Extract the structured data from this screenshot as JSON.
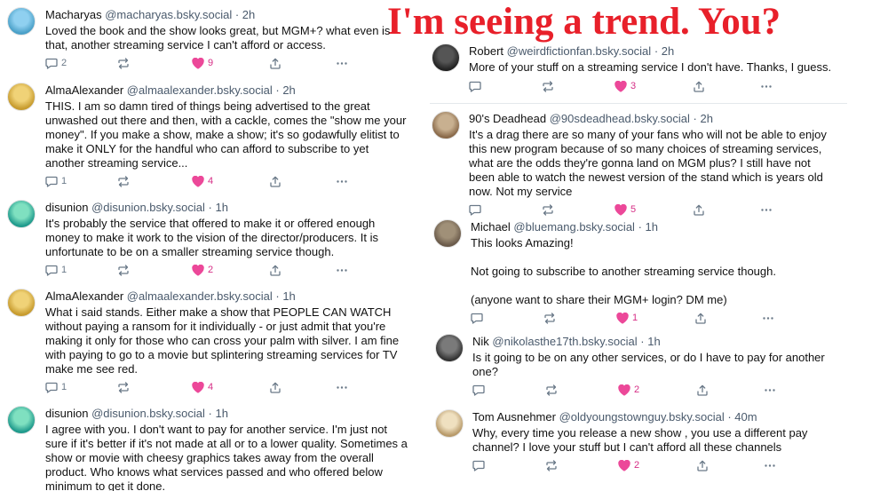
{
  "overlay": {
    "title": "I'm seeing a trend. You?"
  },
  "colors": {
    "heart": "#ec4899",
    "handle": "#4a5a6c",
    "overlay": "#e8202a"
  },
  "posts": [
    {
      "name": "Macharyas",
      "handle": "@macharyas.bsky.social",
      "time": "· 2h",
      "text": "Loved the book and the show looks great, but MGM+? what even is\nthat, another streaming service I can't afford or access.",
      "replies": "2",
      "reposts": "",
      "likes": "9",
      "liked": true
    },
    {
      "name": "AlmaAlexander",
      "handle": "@almaalexander.bsky.social",
      "time": "· 2h",
      "text": "THIS. I am so damn tired of things being advertised to the great\nunwashed out there and then, with a cackle, comes the \"show me your\nmoney\". If you make a show, make a show; it's so godawfully elitist to\nmake it ONLY for the handful who can afford to subscribe to yet\nanother streaming service...",
      "replies": "1",
      "reposts": "",
      "likes": "4",
      "liked": true
    },
    {
      "name": "disunion",
      "handle": "@disunion.bsky.social",
      "time": "· 1h",
      "text": "It's probably the service that offered to make it or offered enough\nmoney to make it work to the vision of the director/producers. It is\nunfortunate to be on a smaller streaming service though.",
      "replies": "1",
      "reposts": "",
      "likes": "2",
      "liked": true
    },
    {
      "name": "AlmaAlexander",
      "handle": "@almaalexander.bsky.social",
      "time": "· 1h",
      "text": "What i said stands. Either make a show that PEOPLE CAN WATCH\nwithout paying a ransom for it individually - or just admit that you're\nmaking it only for those who can cross your palm with silver. I am fine\nwith paying to go to a movie but splintering streaming services for TV\nmake me see red.",
      "replies": "1",
      "reposts": "",
      "likes": "4",
      "liked": true
    },
    {
      "name": "disunion",
      "handle": "@disunion.bsky.social",
      "time": "· 1h",
      "text": "I agree with you. I don't want to pay for another service. I'm just not\nsure if it's better if it's not made at all or to a lower quality. Sometimes a\nshow or movie with cheesy graphics takes away from the overall\nproduct. Who knows what services passed and who offered below\nminimum to get it done.",
      "replies": "",
      "reposts": "",
      "likes": "",
      "liked": false
    },
    {
      "name": "Robert",
      "handle": "@weirdfictionfan.bsky.social",
      "time": "· 2h",
      "text": "More of your stuff on a streaming service I don't have. Thanks, I guess.",
      "replies": "",
      "reposts": "",
      "likes": "3",
      "liked": true
    },
    {
      "name": "90's Deadhead",
      "handle": "@90sdeadhead.bsky.social",
      "time": "· 2h",
      "text": "It's a drag there are so many of your fans who will not be able to enjoy\nthis new program because of so many choices of streaming services,\nwhat are the odds they're gonna land on MGM plus? I still have not\nbeen able to watch the newest version of the stand which is years old\nnow. Not my service",
      "replies": "",
      "reposts": "",
      "likes": "5",
      "liked": true
    },
    {
      "name": "Michael",
      "handle": "@bluemang.bsky.social",
      "time": "· 1h",
      "text": "This looks Amazing!\n\nNot going to subscribe to another streaming service though.\n\n(anyone want to share their MGM+ login? DM me)",
      "replies": "",
      "reposts": "",
      "likes": "1",
      "liked": true
    },
    {
      "name": "Nik",
      "handle": "@nikolasthe17th.bsky.social",
      "time": "· 1h",
      "text": "Is it going to be on any other services, or do I have to pay for another\none?",
      "replies": "",
      "reposts": "",
      "likes": "2",
      "liked": true
    },
    {
      "name": "Tom Ausnehmer",
      "handle": "@oldyoungstownguy.bsky.social",
      "time": "· 40m",
      "text": "Why, every time you release a new show , you use a different pay\nchannel? I love your stuff but I can't afford all these channels",
      "replies": "",
      "reposts": "",
      "likes": "2",
      "liked": true
    }
  ]
}
